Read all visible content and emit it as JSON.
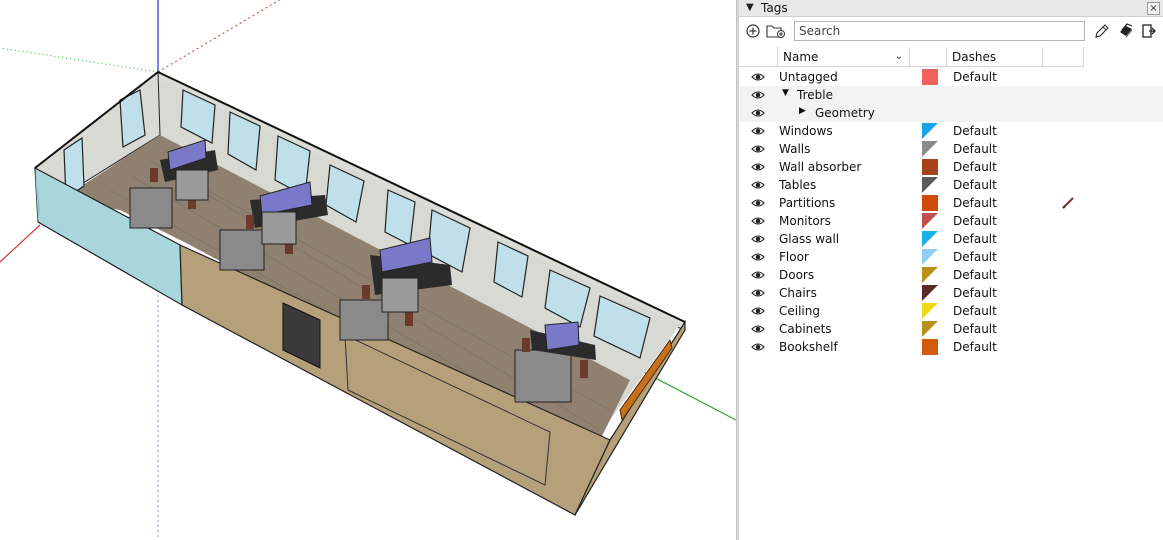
{
  "panel": {
    "title": "Tags",
    "close_glyph": "×",
    "collapse_glyph": "▼"
  },
  "toolbar": {
    "search_placeholder": "Search",
    "add_tag_icon": "plus-circle-icon",
    "add_folder_icon": "folder-plus-icon",
    "color_by_tag_icon": "pencil-icon",
    "dashes_icon": "layers-icon",
    "details_icon": "export-icon"
  },
  "columns": {
    "name": "Name",
    "dashes": "Dashes"
  },
  "tags": [
    {
      "name": "Untagged",
      "color": "#f0605f",
      "dash": "Default",
      "level": 0,
      "kind": "tag",
      "swatch": "solid"
    },
    {
      "name": "Treble",
      "color": "",
      "dash": "",
      "level": 0,
      "kind": "folder-open",
      "swatch": "none"
    },
    {
      "name": "Geometry",
      "color": "",
      "dash": "",
      "level": 1,
      "kind": "folder-closed",
      "swatch": "none"
    },
    {
      "name": "Windows",
      "color": "#1aa3e8",
      "dash": "Default",
      "level": 0,
      "kind": "tag",
      "swatch": "triangle"
    },
    {
      "name": "Walls",
      "color": "#8c8c8c",
      "dash": "Default",
      "level": 0,
      "kind": "tag",
      "swatch": "triangle"
    },
    {
      "name": "Wall absorber",
      "color": "#a8421a",
      "dash": "Default",
      "level": 0,
      "kind": "tag",
      "swatch": "solid"
    },
    {
      "name": "Tables",
      "color": "#5a5a5a",
      "dash": "Default",
      "level": 0,
      "kind": "tag",
      "swatch": "triangle"
    },
    {
      "name": "Partitions",
      "color": "#d04a0c",
      "dash": "Default",
      "level": 0,
      "kind": "tag",
      "swatch": "solid"
    },
    {
      "name": "Monitors",
      "color": "#c0504d",
      "dash": "Default",
      "level": 0,
      "kind": "tag",
      "swatch": "triangle"
    },
    {
      "name": "Glass wall",
      "color": "#1ab0e8",
      "dash": "Default",
      "level": 0,
      "kind": "tag",
      "swatch": "triangle"
    },
    {
      "name": "Floor",
      "color": "#8fcff2",
      "dash": "Default",
      "level": 0,
      "kind": "tag",
      "swatch": "triangle"
    },
    {
      "name": "Doors",
      "color": "#b8901a",
      "dash": "Default",
      "level": 0,
      "kind": "tag",
      "swatch": "triangle"
    },
    {
      "name": "Chairs",
      "color": "#5a2a2a",
      "dash": "Default",
      "level": 0,
      "kind": "tag",
      "swatch": "triangle"
    },
    {
      "name": "Ceiling",
      "color": "#f2d81a",
      "dash": "Default",
      "level": 0,
      "kind": "tag",
      "swatch": "triangle"
    },
    {
      "name": "Cabinets",
      "color": "#b8901a",
      "dash": "Default",
      "level": 0,
      "kind": "tag",
      "swatch": "triangle"
    },
    {
      "name": "Bookshelf",
      "color": "#d05a10",
      "dash": "Default",
      "level": 0,
      "kind": "tag",
      "swatch": "solid"
    }
  ],
  "colors": {
    "axis_red": "#d33a3a",
    "axis_green": "#2aa52a",
    "axis_blue": "#2a2ad0",
    "glass": "#a9d6dc",
    "wall_tan": "#b5a07a",
    "floor": "#8f8070",
    "window_glass": "#bfe0ea",
    "desk": "#2b2b2b",
    "partition": "#7a78c8",
    "chair": "#6a3a2a",
    "cabinet": "#a8a8a8"
  }
}
